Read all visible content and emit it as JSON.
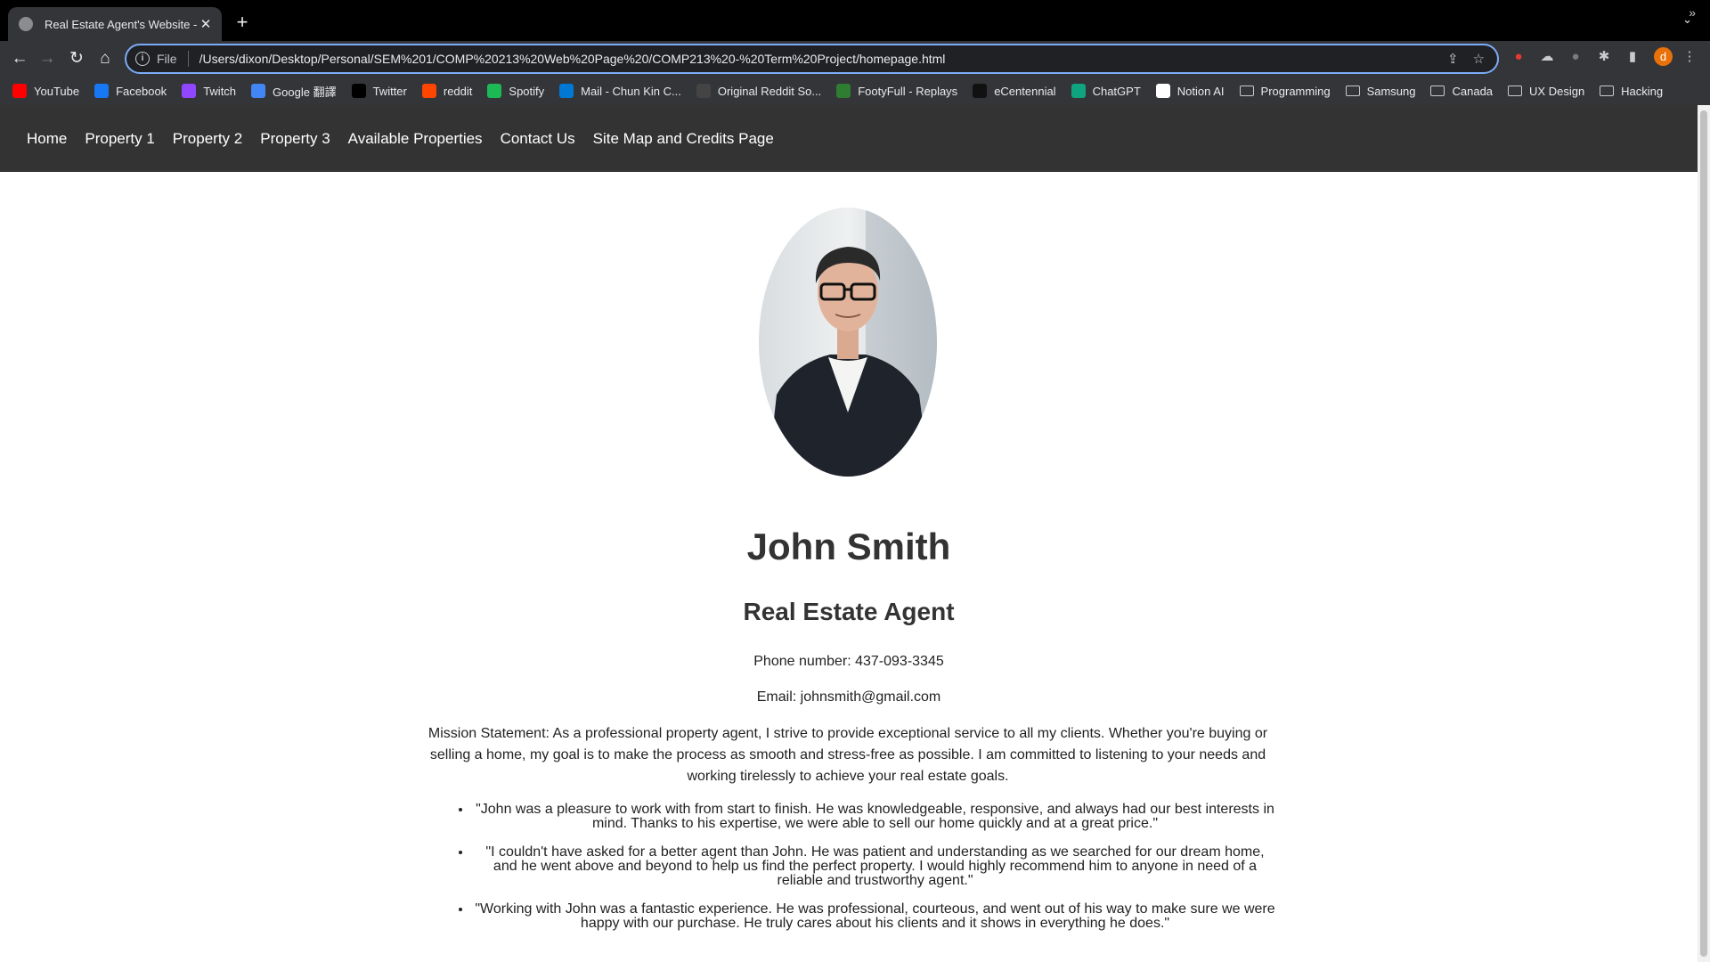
{
  "browser": {
    "tab_title": "Real Estate Agent's Website -",
    "url_scheme": "File",
    "url": "/Users/dixon/Desktop/Personal/SEM%201/COMP%20213%20Web%20Page%20/COMP213%20-%20Term%20Project/homepage.html",
    "profile_initial": "d",
    "bookmarks": [
      {
        "label": "YouTube",
        "icon": "youtube-icon",
        "color": "#ff0000"
      },
      {
        "label": "Facebook",
        "icon": "facebook-icon",
        "color": "#1877f2"
      },
      {
        "label": "Twitch",
        "icon": "twitch-icon",
        "color": "#9146ff"
      },
      {
        "label": "Google 翻譯",
        "icon": "google-translate-icon",
        "color": "#4285f4"
      },
      {
        "label": "Twitter",
        "icon": "x-icon",
        "color": "#000000"
      },
      {
        "label": "reddit",
        "icon": "reddit-icon",
        "color": "#ff4500"
      },
      {
        "label": "Spotify",
        "icon": "spotify-icon",
        "color": "#1db954"
      },
      {
        "label": "Mail - Chun Kin C...",
        "icon": "outlook-icon",
        "color": "#0078d4"
      },
      {
        "label": "Original Reddit So...",
        "icon": "soccer-icon",
        "color": "#444444"
      },
      {
        "label": "FootyFull - Replays",
        "icon": "play-icon",
        "color": "#2e7d32"
      },
      {
        "label": "eCentennial",
        "icon": "centennial-icon",
        "color": "#111111"
      },
      {
        "label": "ChatGPT",
        "icon": "chatgpt-icon",
        "color": "#10a37f"
      },
      {
        "label": "Notion AI",
        "icon": "notion-icon",
        "color": "#ffffff"
      },
      {
        "label": "Programming",
        "icon": "folder-icon"
      },
      {
        "label": "Samsung",
        "icon": "folder-icon"
      },
      {
        "label": "Canada",
        "icon": "folder-icon"
      },
      {
        "label": "UX Design",
        "icon": "folder-icon"
      },
      {
        "label": "Hacking",
        "icon": "folder-icon"
      }
    ]
  },
  "page": {
    "nav": [
      "Home",
      "Property 1",
      "Property 2",
      "Property 3",
      "Available Properties",
      "Contact Us",
      "Site Map and Credits Page"
    ],
    "name": "John Smith",
    "role": "Real Estate Agent",
    "phone": "Phone number: 437-093-3345",
    "email": "Email: johnsmith@gmail.com",
    "mission": "Mission Statement: As a professional property agent, I strive to provide exceptional service to all my clients. Whether you're buying or selling a home, my goal is to make the process as smooth and stress-free as possible. I am committed to listening to your needs and working tirelessly to achieve your real estate goals.",
    "testimonials": [
      "\"John was a pleasure to work with from start to finish. He was knowledgeable, responsive, and always had our best interests in mind. Thanks to his expertise, we were able to sell our home quickly and at a great price.\"",
      "\"I couldn't have asked for a better agent than John. He was patient and understanding as we searched for our dream home, and he went above and beyond to help us find the perfect property. I would highly recommend him to anyone in need of a reliable and trustworthy agent.\"",
      "\"Working with John was a fantastic experience. He was professional, courteous, and went out of his way to make sure we were happy with our purchase. He truly cares about his clients and it shows in everything he does.\""
    ]
  }
}
